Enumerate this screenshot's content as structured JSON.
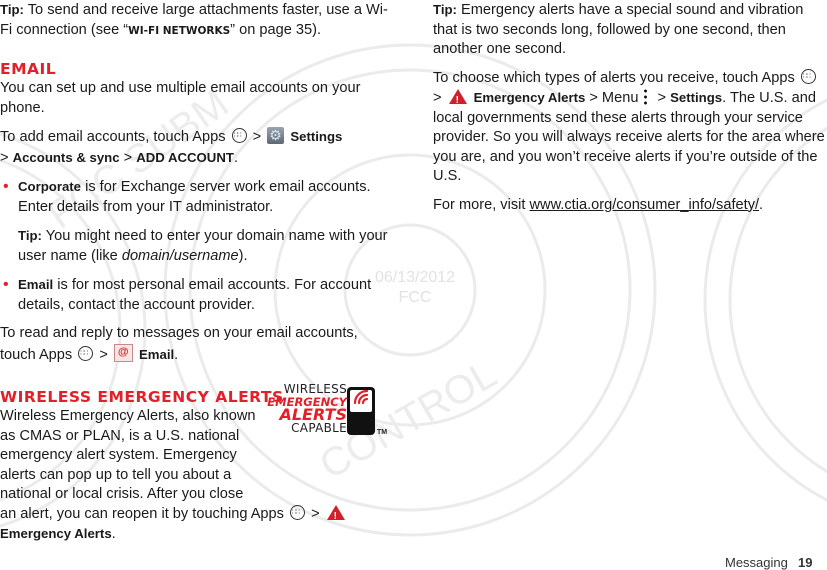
{
  "left_column": {
    "tip1": {
      "label": "Tip:",
      "text_before": " To send and receive large attachments faster, use a Wi-Fi connection (see “",
      "link": "WI-FI NETWORKS",
      "text_after": "” on page 35)."
    },
    "email_section": {
      "heading": "EMAIL",
      "intro": "You can set up and use multiple email accounts on your phone.",
      "add_accounts": {
        "text": "To add email accounts, touch Apps",
        "sep1": " > ",
        "settings": "Settings",
        "sep2": " > ",
        "accounts_sync": "Accounts & sync",
        "sep3": " > ",
        "add_account": "ADD ACCOUNT",
        "end": "."
      },
      "bullets": [
        {
          "bold": "Corporate",
          "text": " is for Exchange server work email accounts. Enter details from your IT administrator."
        },
        {
          "bold": "Email",
          "text": " is for most personal email accounts. For account details, contact the account provider."
        }
      ],
      "tip2": {
        "label": "Tip:",
        "text_before": " You might need to enter your domain name with your user name (like ",
        "italic": "domain/username",
        "text_after": ")."
      },
      "read_reply": {
        "text": "To read and reply to messages on your email accounts, touch Apps",
        "sep": " > ",
        "email": "Email",
        "end": "."
      }
    },
    "wea_section": {
      "heading": "WIRELESS EMERGENCY ALERTS",
      "intro": "Wireless Emergency Alerts, also known as CMAS or PLAN, is a U.S. national emergency alert system. Emergency alerts can pop up to tell you about a national or local crisis. After you close an alert, you can reopen it by touching",
      "apps": "Apps",
      "sep": " > ",
      "emergency_alerts": "Emergency Alerts",
      "end": ".",
      "logo": {
        "line1": "WIRELESS",
        "line2": "EMERGENCY",
        "line3": "ALERTS",
        "line4": "CAPABLE",
        "tm": "TM"
      }
    }
  },
  "right_column": {
    "tip": {
      "label": "Tip:",
      "text": " Emergency alerts have a special sound and vibration that is two seconds long, followed by one second, then another one second."
    },
    "choose": {
      "text": "To choose which types of alerts you receive, touch Apps",
      "sep1": " > ",
      "emergency_alerts": "Emergency Alerts",
      "sep2": " > Menu",
      "sep3": " > ",
      "settings": "Settings",
      "rest": ". The U.S. and local governments send these alerts through your service provider. So you will always receive alerts for the area where you are, and you won’t receive alerts if you’re outside of the U.S."
    },
    "more": {
      "text": "For more, visit ",
      "link": "www.ctia.org/consumer_info/safety/",
      "end": "."
    }
  },
  "watermark": {
    "date": "06/13/2012",
    "agency": "FCC"
  },
  "footer": {
    "section": "Messaging",
    "page": "19"
  },
  "colors": {
    "accent_red": "#e3202a",
    "text": "#1a1a1a",
    "watermark": "#e2e2e2"
  }
}
